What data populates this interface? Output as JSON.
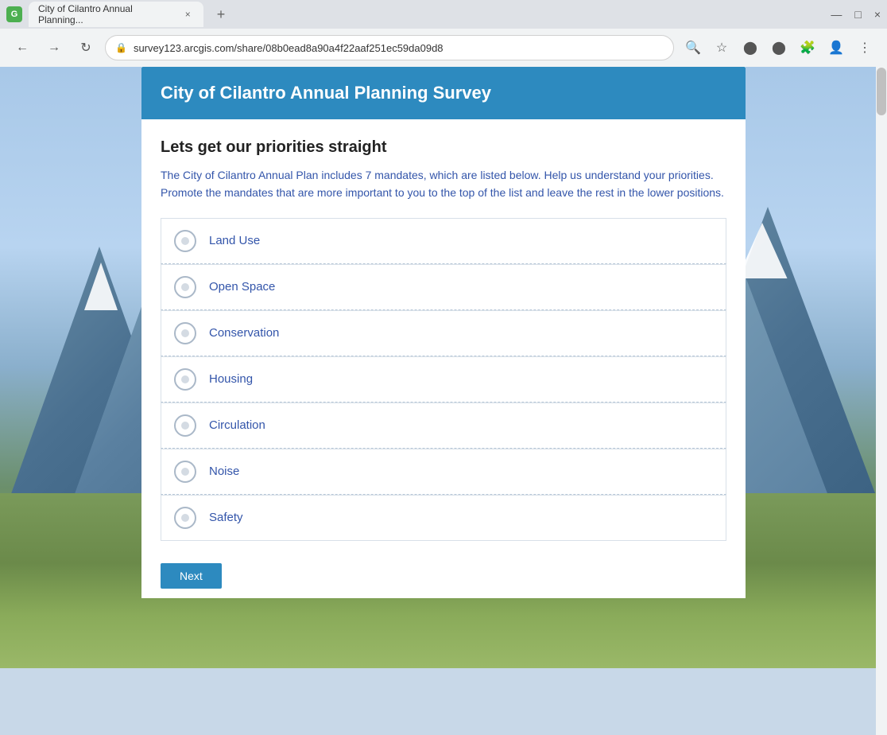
{
  "browser": {
    "tab_icon": "G",
    "tab_title": "City of Cilantro Annual Planning...",
    "tab_close": "×",
    "new_tab": "+",
    "window_minimize": "—",
    "window_maximize": "□",
    "window_close": "×",
    "url": "survey123.arcgis.com/share/08b0ead8a90a4f22aaf251ec59da09d8",
    "nav_back": "←",
    "nav_forward": "→",
    "nav_reload": "↻"
  },
  "survey": {
    "header_title": "City of Cilantro Annual Planning Survey",
    "section_title": "Lets get our priorities straight",
    "description": "The City of Cilantro Annual Plan includes 7 mandates, which are listed below. Help us understand your priorities. Promote the mandates that are more important to you to the top of the list and leave the rest in the lower positions.",
    "items": [
      {
        "label": "Land Use",
        "id": "land-use"
      },
      {
        "label": "Open Space",
        "id": "open-space"
      },
      {
        "label": "Conservation",
        "id": "conservation"
      },
      {
        "label": "Housing",
        "id": "housing"
      },
      {
        "label": "Circulation",
        "id": "circulation"
      },
      {
        "label": "Noise",
        "id": "noise"
      },
      {
        "label": "Safety",
        "id": "safety"
      }
    ],
    "next_button_label": "Next"
  }
}
